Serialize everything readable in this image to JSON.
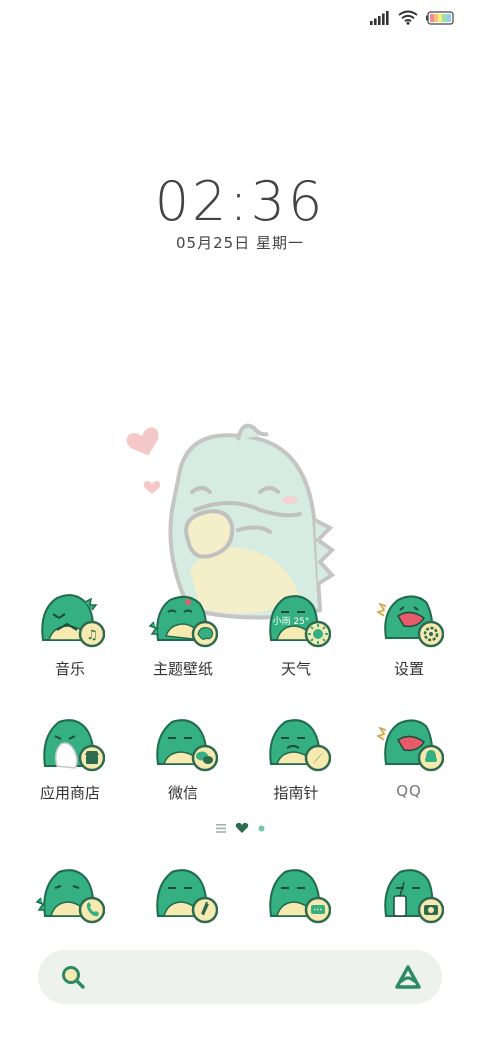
{
  "status_bar": {
    "signal_icon": "signal-bars-icon",
    "wifi_icon": "wifi-icon",
    "battery_icon": "battery-rainbow-icon"
  },
  "clock": {
    "time": "02:36",
    "date": "05月25日 星期一"
  },
  "apps_row1": [
    {
      "label": "音乐",
      "badge_icon": "music-note-icon"
    },
    {
      "label": "主题壁纸",
      "badge_icon": "palette-icon"
    },
    {
      "label": "天气",
      "badge_icon": "sun-icon",
      "widget_text": "小雨 25°"
    },
    {
      "label": "设置",
      "badge_icon": "gear-icon"
    }
  ],
  "apps_row2": [
    {
      "label": "应用商店",
      "badge_icon": "store-icon"
    },
    {
      "label": "微信",
      "badge_icon": "chat-bubbles-icon"
    },
    {
      "label": "指南针",
      "badge_icon": "compass-icon"
    },
    {
      "label": "QQ",
      "badge_icon": "penguin-icon"
    }
  ],
  "dock": [
    {
      "name": "phone",
      "badge_icon": "phone-icon"
    },
    {
      "name": "contacts",
      "badge_icon": "contacts-icon"
    },
    {
      "name": "messages",
      "badge_icon": "message-icon"
    },
    {
      "name": "camera",
      "badge_icon": "camera-icon"
    }
  ],
  "pager": {
    "pages": 3,
    "active": 2
  },
  "search_bar": {
    "left_icon": "search-icon",
    "right_icon": "assistant-a-icon"
  },
  "colors": {
    "dino_green": "#35b083",
    "dino_dark": "#1f7a58",
    "belly": "#f7eab0",
    "badge_ring": "#2e8a63",
    "search_bg": "#eef2ef",
    "wallpaper_green": "#cfe8dc",
    "heart": "#f5b7b7"
  }
}
